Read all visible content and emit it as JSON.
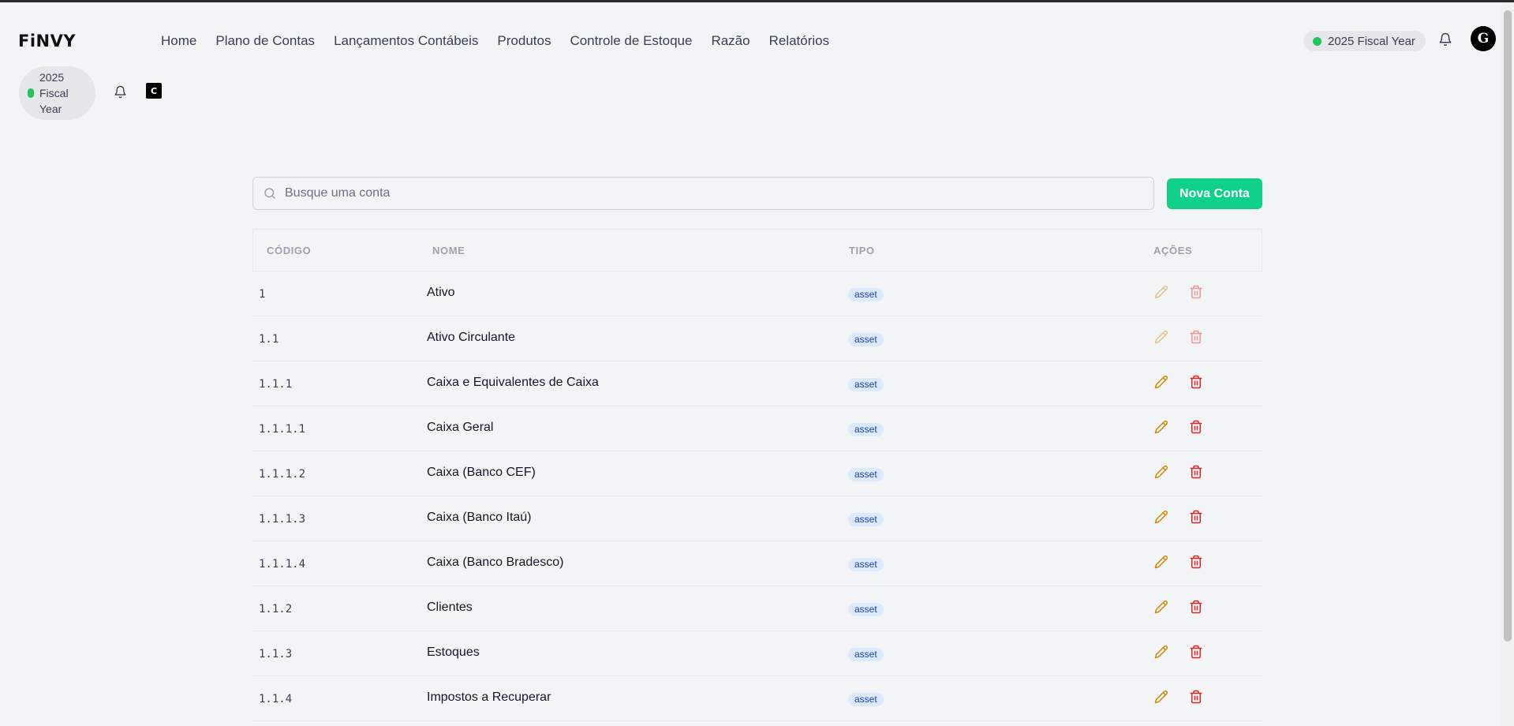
{
  "app": {
    "logo": "FiNVY"
  },
  "nav": [
    "Home",
    "Plano de Contas",
    "Lançamentos Contábeis",
    "Produtos",
    "Controle de Estoque",
    "Razão",
    "Relatórios"
  ],
  "fiscal_year": {
    "label": "2025 Fiscal Year",
    "stacked": [
      "2025",
      "Fiscal",
      "Year"
    ],
    "status_color": "#22c55e"
  },
  "user": {
    "avatar_initial": "G",
    "avatar_small": "C"
  },
  "search": {
    "placeholder": "Busque uma conta",
    "value": ""
  },
  "actions": {
    "new_account": "Nova Conta"
  },
  "colors": {
    "accent": "#10d18a",
    "edit": "#ca8a04",
    "delete": "#dc2626",
    "badge_bg": "#dbeafe",
    "badge_text": "#1e40af"
  },
  "table": {
    "headers": {
      "code": "CÓDIGO",
      "name": "NOME",
      "type": "TIPO",
      "actions": "AÇÕES"
    },
    "rows": [
      {
        "code": "1",
        "name": "Ativo",
        "type": "asset",
        "actions_enabled": false
      },
      {
        "code": "1.1",
        "name": "Ativo Circulante",
        "type": "asset",
        "actions_enabled": false
      },
      {
        "code": "1.1.1",
        "name": "Caixa e Equivalentes de Caixa",
        "type": "asset",
        "actions_enabled": true
      },
      {
        "code": "1.1.1.1",
        "name": "Caixa Geral",
        "type": "asset",
        "actions_enabled": true
      },
      {
        "code": "1.1.1.2",
        "name": "Caixa (Banco CEF)",
        "type": "asset",
        "actions_enabled": true
      },
      {
        "code": "1.1.1.3",
        "name": "Caixa (Banco Itaú)",
        "type": "asset",
        "actions_enabled": true
      },
      {
        "code": "1.1.1.4",
        "name": "Caixa (Banco Bradesco)",
        "type": "asset",
        "actions_enabled": true
      },
      {
        "code": "1.1.2",
        "name": "Clientes",
        "type": "asset",
        "actions_enabled": true
      },
      {
        "code": "1.1.3",
        "name": "Estoques",
        "type": "asset",
        "actions_enabled": true
      },
      {
        "code": "1.1.4",
        "name": "Impostos a Recuperar",
        "type": "asset",
        "actions_enabled": true
      }
    ]
  }
}
